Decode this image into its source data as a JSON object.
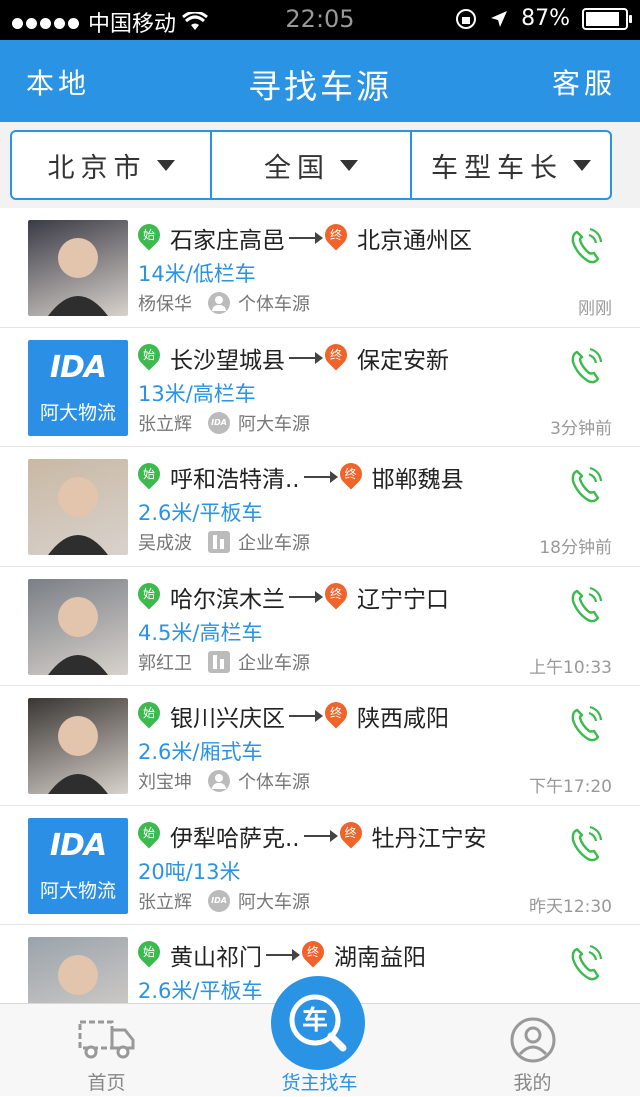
{
  "status_bar": {
    "carrier": "中国移动",
    "time": "22:05",
    "battery": "87%",
    "battery_level": 0.87
  },
  "nav": {
    "left": "本地",
    "title": "寻找车源",
    "right": "客服"
  },
  "filters": [
    {
      "label": "北京市"
    },
    {
      "label": "全国"
    },
    {
      "label": "车型车长"
    }
  ],
  "listings": [
    {
      "avatar": "photo",
      "from": "石家庄高邑",
      "to": "北京通州区",
      "spec": "14米/低栏车",
      "name": "杨保华",
      "source_icon": "person-icon",
      "source": "个体车源",
      "time": "刚刚"
    },
    {
      "avatar": "logo",
      "from": "长沙望城县",
      "to": "保定安新",
      "spec": "13米/高栏车",
      "name": "张立辉",
      "source_icon": "ida-icon",
      "source": "阿大车源",
      "time": "3分钟前"
    },
    {
      "avatar": "photo",
      "from": "呼和浩特清..",
      "to": "邯郸魏县",
      "spec": "2.6米/平板车",
      "name": "吴成波",
      "source_icon": "company-icon",
      "source": "企业车源",
      "time": "18分钟前"
    },
    {
      "avatar": "photo",
      "from": "哈尔滨木兰",
      "to": "辽宁宁口",
      "spec": "4.5米/高栏车",
      "name": "郭红卫",
      "source_icon": "company-icon",
      "source": "企业车源",
      "time": "上午10:33"
    },
    {
      "avatar": "photo",
      "from": "银川兴庆区",
      "to": "陕西咸阳",
      "spec": "2.6米/厢式车",
      "name": "刘宝坤",
      "source_icon": "person-icon",
      "source": "个体车源",
      "time": "下午17:20"
    },
    {
      "avatar": "logo",
      "from": "伊犁哈萨克..",
      "to": "牡丹江宁安",
      "spec": "20吨/13米",
      "name": "张立辉",
      "source_icon": "ida-icon",
      "source": "阿大车源",
      "time": "昨天12:30"
    },
    {
      "avatar": "photo",
      "from": "黄山祁门",
      "to": "湖南益阳",
      "spec": "2.6米/平板车",
      "name": "",
      "source_icon": "",
      "source": "",
      "time": ""
    }
  ],
  "pins": {
    "start": "始",
    "end": "终"
  },
  "logo": {
    "mark": "IDA",
    "text": "阿大物流"
  },
  "tabs": {
    "home": "首页",
    "find": "货主找车",
    "fab": "车",
    "mine": "我的"
  },
  "colors": {
    "accent": "#2b93e3",
    "start_pin": "#3dba4e",
    "end_pin": "#f0632a",
    "phone": "#3dba4e"
  }
}
